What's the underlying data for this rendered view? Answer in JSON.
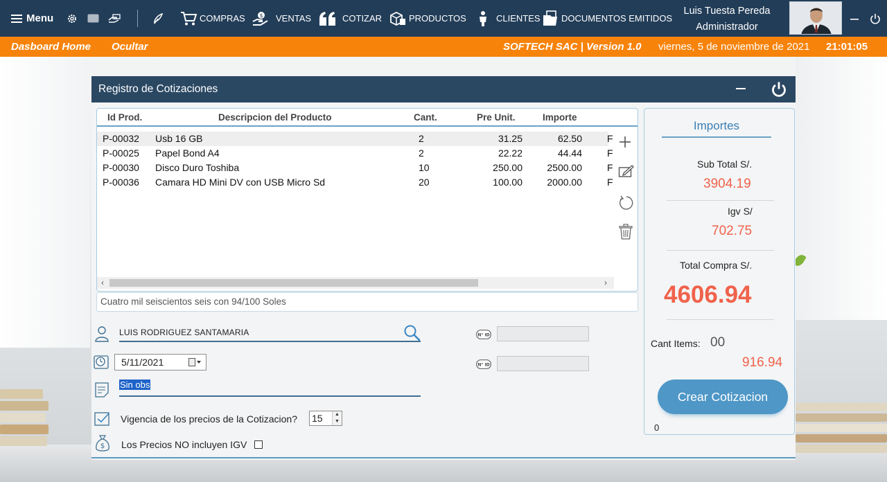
{
  "topbar": {
    "menu_label": "Menu",
    "nav": [
      {
        "label": "COMPRAS",
        "icon": "cart-icon"
      },
      {
        "label": "VENTAS",
        "icon": "hand-coin-icon"
      },
      {
        "label": "COTIZAR",
        "icon": "quote-icon"
      },
      {
        "label": "PRODUCTOS",
        "icon": "boxes-icon"
      },
      {
        "label": "CLIENTES",
        "icon": "people-icon"
      },
      {
        "label": "DOCUMENTOS EMITIDOS",
        "icon": "documents-icon"
      }
    ],
    "user_name": "Luis Tuesta Pereda",
    "user_role": "Administrador"
  },
  "orangebar": {
    "dashboard": "Dasboard Home",
    "hide": "Ocultar",
    "company": "SOFTECH SAC | Version 1.0",
    "date": "viernes, 5 de noviembre de 2021",
    "time": "21:01:05"
  },
  "window": {
    "title": "Registro de Cotizaciones"
  },
  "table": {
    "columns": [
      "Id Prod.",
      "Descripcion del Producto",
      "Cant.",
      "Pre Unit.",
      "Importe"
    ],
    "rows": [
      [
        "P-00032",
        "Usb 16 GB",
        "2",
        "31.25",
        "62.50",
        "F"
      ],
      [
        "P-00025",
        "Papel Bond A4",
        "2",
        "22.22",
        "44.44",
        "F"
      ],
      [
        "P-00030",
        "Disco Duro Toshiba",
        "10",
        "250.00",
        "2500.00",
        "F"
      ],
      [
        "P-00036",
        "Camara HD Mini DV con USB Micro Sd",
        "20",
        "100.00",
        "2000.00",
        "F"
      ]
    ],
    "scroll_left": "‹",
    "scroll_right": "›"
  },
  "amount_words": "Cuatro mil seiscientos seis con 94/100 Soles",
  "form": {
    "client_name": "LUIS RODRIGUEZ SANTAMARIA",
    "nid_badge_1": "N° ID",
    "nid_badge_2": "N° ID",
    "date_value": "5/11/2021",
    "observation": "Sin obs",
    "validity_label": "Vigencia de los precios de la Cotizacion?",
    "validity_value": "15",
    "igv_label": "Los Precios NO incluyen IGV"
  },
  "importes": {
    "title": "Importes",
    "subtotal_label": "Sub Total S/.",
    "subtotal_value": "3904.19",
    "igv_label": "Igv S/",
    "igv_value": "702.75",
    "total_label": "Total Compra S/.",
    "total_value": "4606.94",
    "items_label": "Cant Items:",
    "items_value": "00",
    "extra_value": "916.94",
    "create_button": "Crear Cotizacion",
    "footer_zero": "0"
  },
  "colors": {
    "topbar": "#223d58",
    "orange": "#f7830b",
    "window_header": "#2b4863",
    "accent_blue": "#4e97c7",
    "amount_red": "#f0624b"
  }
}
